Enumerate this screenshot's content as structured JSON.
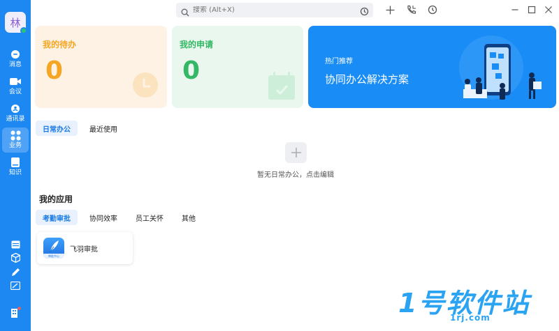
{
  "user": {
    "avatar_char": "林"
  },
  "sidebar": {
    "items": [
      {
        "label": "消息",
        "icon": "message-icon"
      },
      {
        "label": "会议",
        "icon": "video-icon"
      },
      {
        "label": "通讯录",
        "icon": "contacts-icon"
      },
      {
        "label": "业务",
        "icon": "apps-grid-icon",
        "active": true
      },
      {
        "label": "知识",
        "icon": "book-icon"
      }
    ],
    "bottom_icons": [
      "calendar-icon",
      "cube-icon",
      "pen-icon",
      "cast-icon",
      "building-icon"
    ]
  },
  "search": {
    "placeholder": "搜索 (Alt+X)"
  },
  "cards": {
    "todo": {
      "title": "我的待办",
      "count": "0",
      "color": "#f5a623"
    },
    "apply": {
      "title": "我的申请",
      "count": "0",
      "color": "#34b865"
    },
    "promo": {
      "small": "热门推荐",
      "big": "协同办公解决方案",
      "color": "#1a8cf5"
    }
  },
  "office_tabs": [
    {
      "label": "日常办公",
      "active": true
    },
    {
      "label": "最近使用",
      "active": false
    }
  ],
  "empty_text": "暂无日常办公，点击编辑",
  "apps_title": "我的应用",
  "app_tabs": [
    {
      "label": "考勤审批",
      "active": true
    },
    {
      "label": "协同效率",
      "active": false
    },
    {
      "label": "员工关怀",
      "active": false
    },
    {
      "label": "其他",
      "active": false
    }
  ],
  "apps": [
    {
      "name": "飞羽审批",
      "badge": "审批中心"
    }
  ],
  "watermark": {
    "big": "1号软件站",
    "small": "1rj.com"
  },
  "colors": {
    "sidebar": "#1e88f2",
    "accent": "#1a7ae6"
  }
}
